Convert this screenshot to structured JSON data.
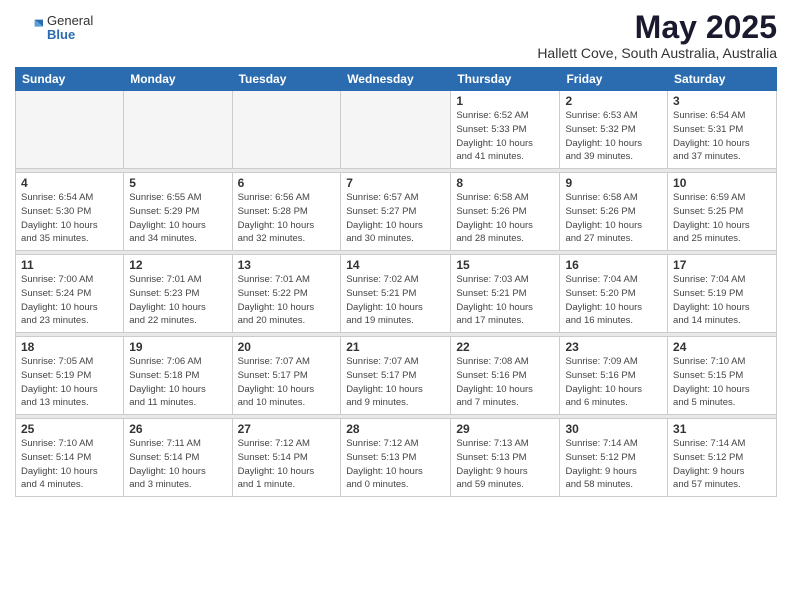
{
  "logo": {
    "general": "General",
    "blue": "Blue"
  },
  "header": {
    "title": "May 2025",
    "location": "Hallett Cove, South Australia, Australia"
  },
  "weekdays": [
    "Sunday",
    "Monday",
    "Tuesday",
    "Wednesday",
    "Thursday",
    "Friday",
    "Saturday"
  ],
  "weeks": [
    [
      {
        "day": "",
        "info": ""
      },
      {
        "day": "",
        "info": ""
      },
      {
        "day": "",
        "info": ""
      },
      {
        "day": "",
        "info": ""
      },
      {
        "day": "1",
        "info": "Sunrise: 6:52 AM\nSunset: 5:33 PM\nDaylight: 10 hours\nand 41 minutes."
      },
      {
        "day": "2",
        "info": "Sunrise: 6:53 AM\nSunset: 5:32 PM\nDaylight: 10 hours\nand 39 minutes."
      },
      {
        "day": "3",
        "info": "Sunrise: 6:54 AM\nSunset: 5:31 PM\nDaylight: 10 hours\nand 37 minutes."
      }
    ],
    [
      {
        "day": "4",
        "info": "Sunrise: 6:54 AM\nSunset: 5:30 PM\nDaylight: 10 hours\nand 35 minutes."
      },
      {
        "day": "5",
        "info": "Sunrise: 6:55 AM\nSunset: 5:29 PM\nDaylight: 10 hours\nand 34 minutes."
      },
      {
        "day": "6",
        "info": "Sunrise: 6:56 AM\nSunset: 5:28 PM\nDaylight: 10 hours\nand 32 minutes."
      },
      {
        "day": "7",
        "info": "Sunrise: 6:57 AM\nSunset: 5:27 PM\nDaylight: 10 hours\nand 30 minutes."
      },
      {
        "day": "8",
        "info": "Sunrise: 6:58 AM\nSunset: 5:26 PM\nDaylight: 10 hours\nand 28 minutes."
      },
      {
        "day": "9",
        "info": "Sunrise: 6:58 AM\nSunset: 5:26 PM\nDaylight: 10 hours\nand 27 minutes."
      },
      {
        "day": "10",
        "info": "Sunrise: 6:59 AM\nSunset: 5:25 PM\nDaylight: 10 hours\nand 25 minutes."
      }
    ],
    [
      {
        "day": "11",
        "info": "Sunrise: 7:00 AM\nSunset: 5:24 PM\nDaylight: 10 hours\nand 23 minutes."
      },
      {
        "day": "12",
        "info": "Sunrise: 7:01 AM\nSunset: 5:23 PM\nDaylight: 10 hours\nand 22 minutes."
      },
      {
        "day": "13",
        "info": "Sunrise: 7:01 AM\nSunset: 5:22 PM\nDaylight: 10 hours\nand 20 minutes."
      },
      {
        "day": "14",
        "info": "Sunrise: 7:02 AM\nSunset: 5:21 PM\nDaylight: 10 hours\nand 19 minutes."
      },
      {
        "day": "15",
        "info": "Sunrise: 7:03 AM\nSunset: 5:21 PM\nDaylight: 10 hours\nand 17 minutes."
      },
      {
        "day": "16",
        "info": "Sunrise: 7:04 AM\nSunset: 5:20 PM\nDaylight: 10 hours\nand 16 minutes."
      },
      {
        "day": "17",
        "info": "Sunrise: 7:04 AM\nSunset: 5:19 PM\nDaylight: 10 hours\nand 14 minutes."
      }
    ],
    [
      {
        "day": "18",
        "info": "Sunrise: 7:05 AM\nSunset: 5:19 PM\nDaylight: 10 hours\nand 13 minutes."
      },
      {
        "day": "19",
        "info": "Sunrise: 7:06 AM\nSunset: 5:18 PM\nDaylight: 10 hours\nand 11 minutes."
      },
      {
        "day": "20",
        "info": "Sunrise: 7:07 AM\nSunset: 5:17 PM\nDaylight: 10 hours\nand 10 minutes."
      },
      {
        "day": "21",
        "info": "Sunrise: 7:07 AM\nSunset: 5:17 PM\nDaylight: 10 hours\nand 9 minutes."
      },
      {
        "day": "22",
        "info": "Sunrise: 7:08 AM\nSunset: 5:16 PM\nDaylight: 10 hours\nand 7 minutes."
      },
      {
        "day": "23",
        "info": "Sunrise: 7:09 AM\nSunset: 5:16 PM\nDaylight: 10 hours\nand 6 minutes."
      },
      {
        "day": "24",
        "info": "Sunrise: 7:10 AM\nSunset: 5:15 PM\nDaylight: 10 hours\nand 5 minutes."
      }
    ],
    [
      {
        "day": "25",
        "info": "Sunrise: 7:10 AM\nSunset: 5:14 PM\nDaylight: 10 hours\nand 4 minutes."
      },
      {
        "day": "26",
        "info": "Sunrise: 7:11 AM\nSunset: 5:14 PM\nDaylight: 10 hours\nand 3 minutes."
      },
      {
        "day": "27",
        "info": "Sunrise: 7:12 AM\nSunset: 5:14 PM\nDaylight: 10 hours\nand 1 minute."
      },
      {
        "day": "28",
        "info": "Sunrise: 7:12 AM\nSunset: 5:13 PM\nDaylight: 10 hours\nand 0 minutes."
      },
      {
        "day": "29",
        "info": "Sunrise: 7:13 AM\nSunset: 5:13 PM\nDaylight: 9 hours\nand 59 minutes."
      },
      {
        "day": "30",
        "info": "Sunrise: 7:14 AM\nSunset: 5:12 PM\nDaylight: 9 hours\nand 58 minutes."
      },
      {
        "day": "31",
        "info": "Sunrise: 7:14 AM\nSunset: 5:12 PM\nDaylight: 9 hours\nand 57 minutes."
      }
    ]
  ]
}
